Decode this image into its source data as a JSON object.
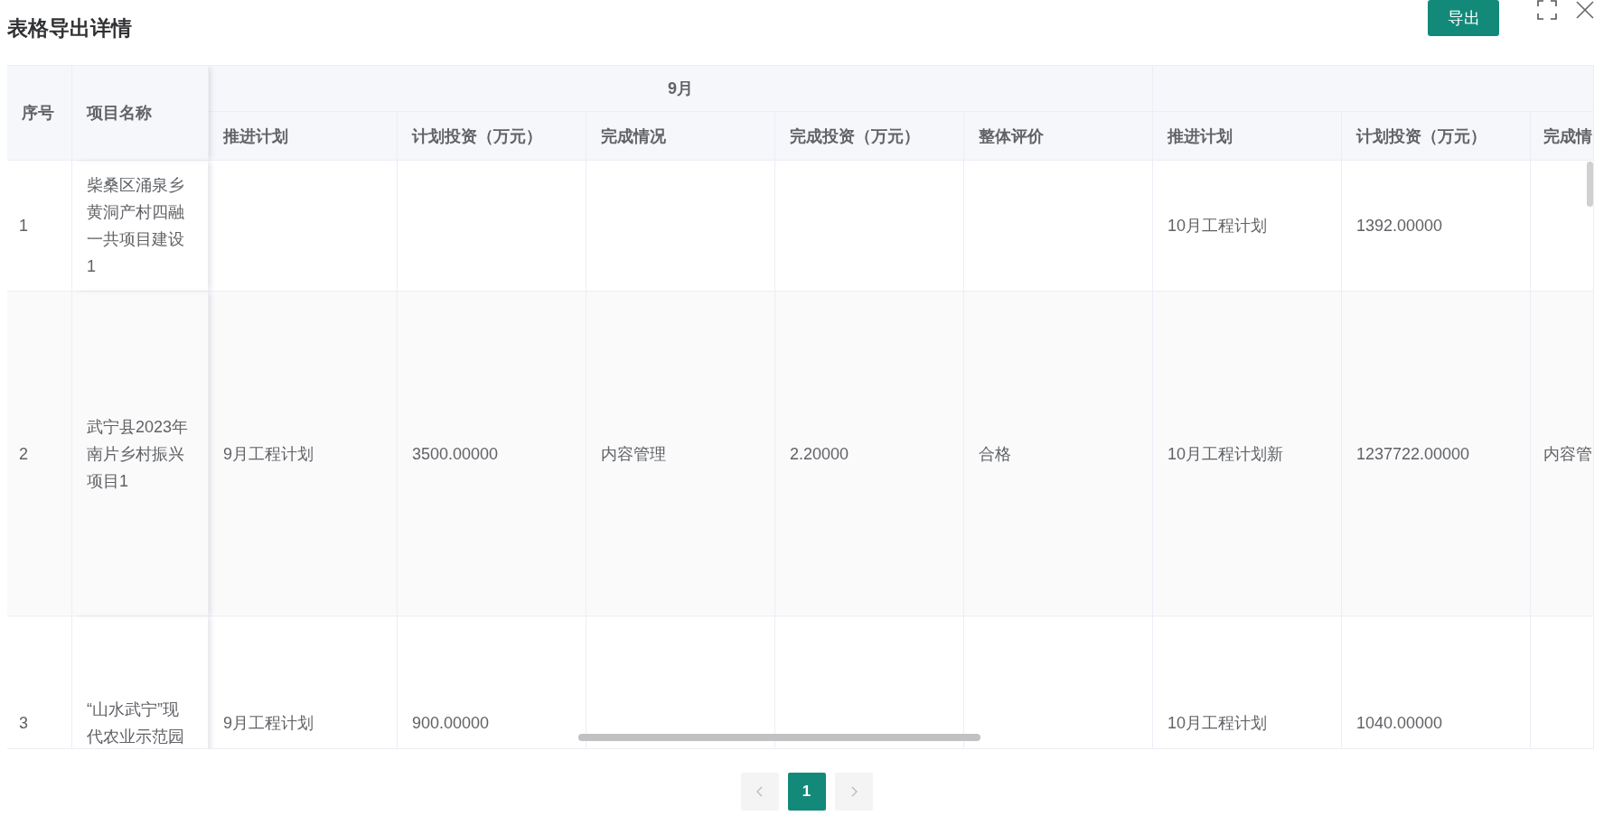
{
  "dialog": {
    "title": "表格导出详情",
    "export_button": "导出"
  },
  "table": {
    "fixed_columns": [
      "序号",
      "项目名称"
    ],
    "groups": [
      {
        "label": "9月",
        "columns": [
          "推进计划",
          "计划投资（万元）",
          "完成情况",
          "完成投资（万元）",
          "整体评价"
        ]
      },
      {
        "columns": [
          "推进计划",
          "计划投资（万元）",
          "完成情"
        ]
      }
    ],
    "rows": [
      {
        "index": "1",
        "name": "柴桑区涌泉乡黄洞产村四融一共项目建设1",
        "cells": [
          null,
          null,
          null,
          null,
          null,
          "10月工程计划",
          "1392.00000",
          null
        ]
      },
      {
        "index": "2",
        "name": "武宁县2023年南片乡村振兴项目1",
        "cells": [
          "9月工程计划",
          "3500.00000",
          "内容管理",
          "2.20000",
          "合格",
          "10月工程计划新",
          "1237722.00000",
          "内容管"
        ]
      },
      {
        "index": "3",
        "name": "“山水武宁”现代农业示范园",
        "cells": [
          "9月工程计划",
          "900.00000",
          null,
          null,
          null,
          "10月工程计划",
          "1040.00000",
          null
        ]
      }
    ]
  },
  "pagination": {
    "pages": [
      {
        "label": "1",
        "selected": true
      }
    ]
  }
}
